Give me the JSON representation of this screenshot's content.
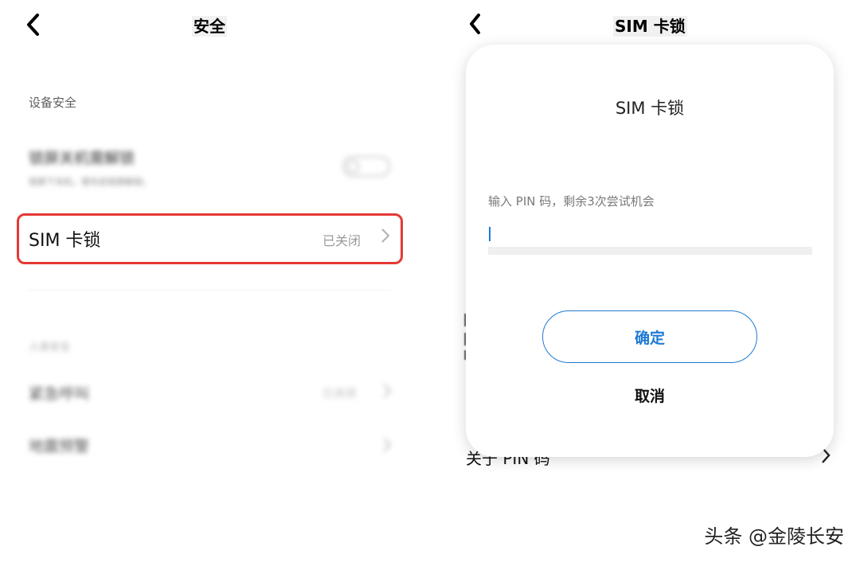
{
  "left_screen": {
    "title": "安全",
    "section_device": "设备安全",
    "lock_row": {
      "title": "锁屏关机需解锁",
      "subtitle": "锁屏下关机，需先经锁屏解锁。"
    },
    "sim_row": {
      "label": "SIM 卡锁",
      "status": "已关闭"
    },
    "section_personal": "人身安全",
    "emergency_row": {
      "label": "紧急呼叫",
      "status": "已关闭"
    },
    "quake_row": {
      "label": "地震预警"
    }
  },
  "right_screen": {
    "title": "SIM 卡锁",
    "behind_row_label": "关于 PIN 码",
    "dialog": {
      "title": "SIM 卡锁",
      "pin_hint": "输入 PIN 码，剩余3次尝试机会",
      "pin_value": "",
      "confirm_label": "确定",
      "cancel_label": "取消"
    }
  },
  "watermark": "头条 @金陵长安",
  "colors": {
    "highlight_border": "#e53935",
    "accent_blue": "#1e7bd4"
  },
  "icons": {
    "back": "back-arrow-icon",
    "chevron": "chevron-right-icon"
  }
}
